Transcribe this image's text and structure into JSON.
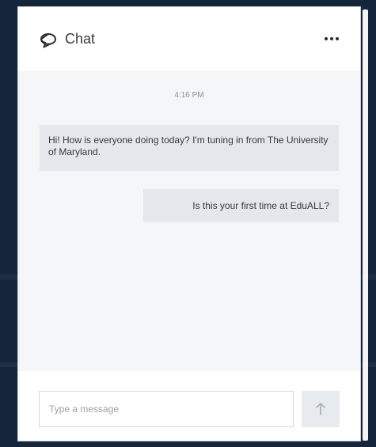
{
  "chat": {
    "title": "Chat",
    "icons": {
      "header": "chat-bubble-icon",
      "more": "more-horizontal-icon",
      "send": "arrow-up-icon"
    },
    "timestamp": "4:16 PM",
    "messages": [
      {
        "text": "Hi! How is everyone doing today? I'm tuning in from The University of Maryland."
      },
      {
        "text": "Is this your first time at EduALL?"
      }
    ],
    "input": {
      "placeholder": "Type a message",
      "value": ""
    }
  },
  "colors": {
    "page_background": "#15263a",
    "chat_background": "#f5f6f7",
    "bubble": "#e4e7eb",
    "send_button": "#e7eaee"
  }
}
